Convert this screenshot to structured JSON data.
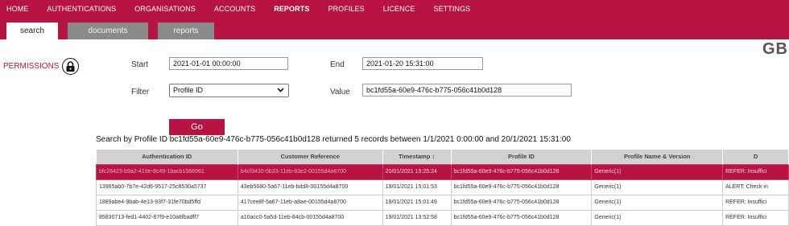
{
  "topnav": {
    "items": [
      {
        "label": "HOME",
        "active": false
      },
      {
        "label": "AUTHENTICATIONS",
        "active": false
      },
      {
        "label": "ORGANISATIONS",
        "active": false
      },
      {
        "label": "ACCOUNTS",
        "active": false
      },
      {
        "label": "REPORTS",
        "active": true
      },
      {
        "label": "PROFILES",
        "active": false
      },
      {
        "label": "LICENCE",
        "active": false
      },
      {
        "label": "SETTINGS",
        "active": false
      }
    ]
  },
  "subtabs": [
    "search",
    "documents",
    "reports"
  ],
  "brand": "GB",
  "permissions": {
    "label": "PERMISSIONS",
    "icon": "lock-icon"
  },
  "form": {
    "start_label": "Start",
    "start_value": "2021-01-01 00:00:00",
    "end_label": "End",
    "end_value": "2021-01-20 15:31:00",
    "filter_label": "Filter",
    "filter_value": "Profile ID",
    "value_label": "Value",
    "value_value": "bc1fd55a-60e9-476c-b775-056c41b0d128",
    "go_label": "Go"
  },
  "summary": "Search by Profile ID bc1fd55a-60e9-476c-b775-056c41b0d128 returned 5 records between 1/1/2021 0:00:00 and 20/1/2021 15:31:00",
  "table": {
    "columns": [
      "Authentication ID",
      "Customer Reference",
      "Timestamp ↕",
      "Profile ID",
      "Profile Name & Version",
      "D"
    ],
    "rows": [
      [
        "bfc28423-b9a2-419e-8c49-1bacb1566961",
        "b4cf3430-5b33-11eb-83e2-00155d4a8700",
        "20/01/2021 15:25:24",
        "bc1fd55a-60e9-476c-b775-056c41b0d128",
        "Generic(1)",
        "REFER: Insuffici"
      ],
      [
        "13965ab0-7b7e-42d6-9517-25c8530a5737",
        "43eb5680-5a67-11eb-bdd8-00155d4a8700",
        "19/01/2021 15:01:53",
        "bc1fd55a-60e9-476c-b775-056c41b0d128",
        "Generic(1)",
        "ALERT: Check in"
      ],
      [
        "1889abe4-9bab-4e13-93f7-31fe70bd5ffd",
        "417cee8f-5a67-11eb-a8ae-00155d4a8700",
        "19/01/2021 15:01:49",
        "bc1fd55a-60e9-476c-b775-056c41b0d128",
        "Generic(1)",
        "REFER: Insuffici"
      ],
      [
        "85830713-fed1-4402-87f9-e10a8fbadff7",
        "a10acc0-5a5d-11eb-84cb-00155d4a8700",
        "19/01/2021 13:52:58",
        "bc1fd55a-60e9-476c-b775-056c41b0d128",
        "Generic(1)",
        "REFER: Insuffici"
      ]
    ]
  },
  "colors": {
    "brand_crimson": "#b81443",
    "tab_grey": "#8a8a8a",
    "header_grey": "#d2d2d2"
  }
}
